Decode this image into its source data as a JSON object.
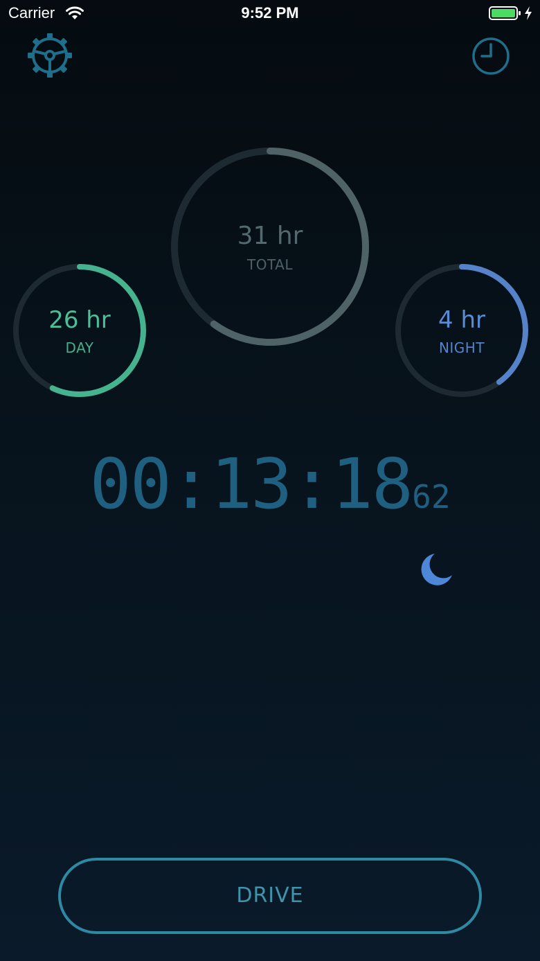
{
  "status_bar": {
    "carrier": "Carrier",
    "time": "9:52 PM",
    "battery_color": "#4cd964"
  },
  "icons": {
    "settings": "steering-wheel-gear-icon",
    "history": "clock-icon",
    "mode": "moon-icon"
  },
  "rings": {
    "total": {
      "value": "31 hr",
      "label": "TOTAL",
      "progress": 0.6,
      "color": "#4f6266"
    },
    "day": {
      "value": "26 hr",
      "label": "DAY",
      "progress": 0.57,
      "color": "#46b38f"
    },
    "night": {
      "value": "4 hr",
      "label": "NIGHT",
      "progress": 0.4,
      "color": "#5682c9"
    }
  },
  "timer": {
    "main": "00:13:18",
    "sub": "62"
  },
  "drive_button": {
    "label": "DRIVE"
  },
  "colors": {
    "accent": "#2e8aa3",
    "timer": "#1f5f80",
    "track": "#1e2a31"
  }
}
